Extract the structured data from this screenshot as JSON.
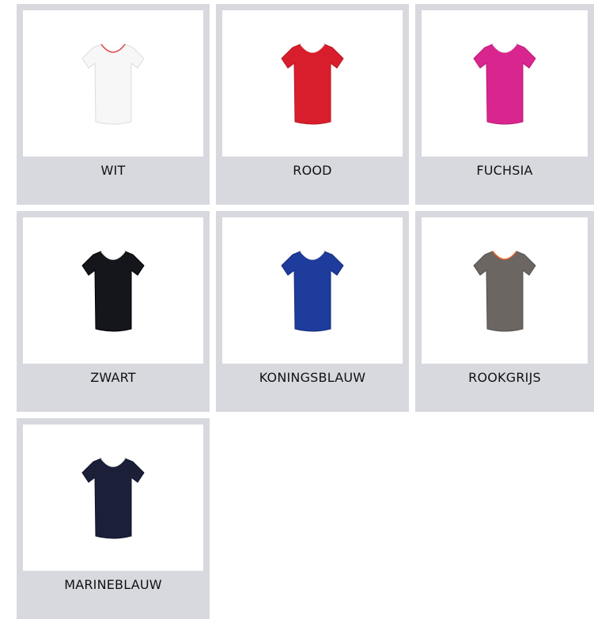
{
  "colors": [
    {
      "label": "WIT",
      "fill": "#f7f7f7",
      "stroke": "#dcdcdc",
      "collar": "#e04a4a"
    },
    {
      "label": "ROOD",
      "fill": "#d81e2c",
      "stroke": "#b81522",
      "collar": "#f4f4f4"
    },
    {
      "label": "FUCHSIA",
      "fill": "#d9268f",
      "stroke": "#b91a76",
      "collar": "#f4f4f4"
    },
    {
      "label": "ZWART",
      "fill": "#15151c",
      "stroke": "#000000",
      "collar": "#f4f4f4"
    },
    {
      "label": "KONINGSBLAUW",
      "fill": "#1e3c9c",
      "stroke": "#152c78",
      "collar": "#f4f4f4"
    },
    {
      "label": "ROOKGRIJS",
      "fill": "#6c6663",
      "stroke": "#55504d",
      "collar": "#e0602a"
    },
    {
      "label": "MARINEBLAUW",
      "fill": "#1b1f38",
      "stroke": "#10132a",
      "collar": "#f4f4f4"
    }
  ]
}
